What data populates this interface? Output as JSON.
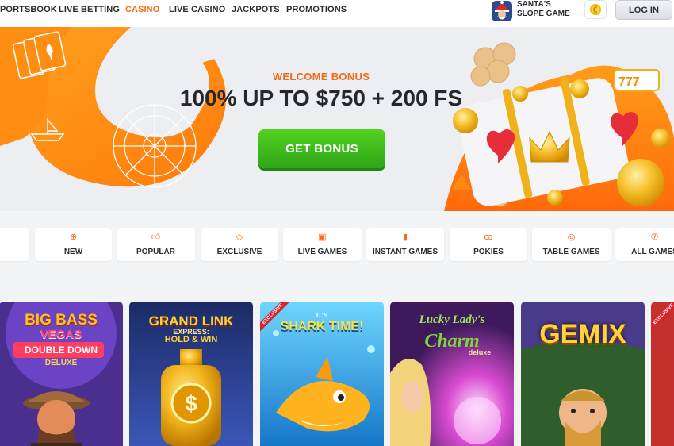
{
  "nav": {
    "items": [
      {
        "label": "PORTSBOOK",
        "active": false
      },
      {
        "label": "LIVE BETTING",
        "active": false
      },
      {
        "label": "CASINO",
        "active": true
      },
      {
        "label": "LIVE CASINO",
        "active": false
      },
      {
        "label": "JACKPOTS",
        "active": false
      },
      {
        "label": "PROMOTIONS",
        "active": false
      }
    ],
    "featured_game": {
      "line1": "SANTA'S",
      "line2": "SLOPE GAME"
    },
    "login_label": "LOG IN",
    "accent_color": "#ff6a13"
  },
  "hero": {
    "subtitle": "WELCOME BONUS",
    "title": "100% UP TO $750 + 200 FS",
    "button_label": "GET BONUS",
    "button_color": "#3bb81c"
  },
  "categories": [
    {
      "label": "",
      "icon": "blank"
    },
    {
      "label": "NEW",
      "icon": "plus-circle-icon"
    },
    {
      "label": "POPULAR",
      "icon": "thumbs-up-icon"
    },
    {
      "label": "EXCLUSIVE",
      "icon": "diamond-icon"
    },
    {
      "label": "LIVE GAMES",
      "icon": "cards-icon"
    },
    {
      "label": "INSTANT GAMES",
      "icon": "rocket-icon"
    },
    {
      "label": "POKIES",
      "icon": "cherries-icon"
    },
    {
      "label": "TABLE GAMES",
      "icon": "roulette-icon"
    },
    {
      "label": "ALL GAMES",
      "icon": "seven-icon"
    }
  ],
  "games": [
    {
      "title_line1": "BIG BASS",
      "title_line2": "VEGAS",
      "title_line3": "DOUBLE DOWN",
      "title_line4": "DELUXE",
      "exclusive": false
    },
    {
      "title_line1": "GRAND LINK",
      "title_line2": "EXPRESS:",
      "title_line3": "HOLD & WIN",
      "exclusive": false
    },
    {
      "title_line1": "IT'S",
      "title_line2": "SHARK TIME!",
      "exclusive": true,
      "badge": "EXCLUSIVE"
    },
    {
      "title_line1": "Lucky Lady's",
      "title_line2": "Charm",
      "title_line3": "deluxe",
      "exclusive": false
    },
    {
      "title_line1": "GEMIX",
      "exclusive": false
    },
    {
      "title_line1": "",
      "exclusive": true,
      "badge": "EXCLUSIVE"
    }
  ]
}
